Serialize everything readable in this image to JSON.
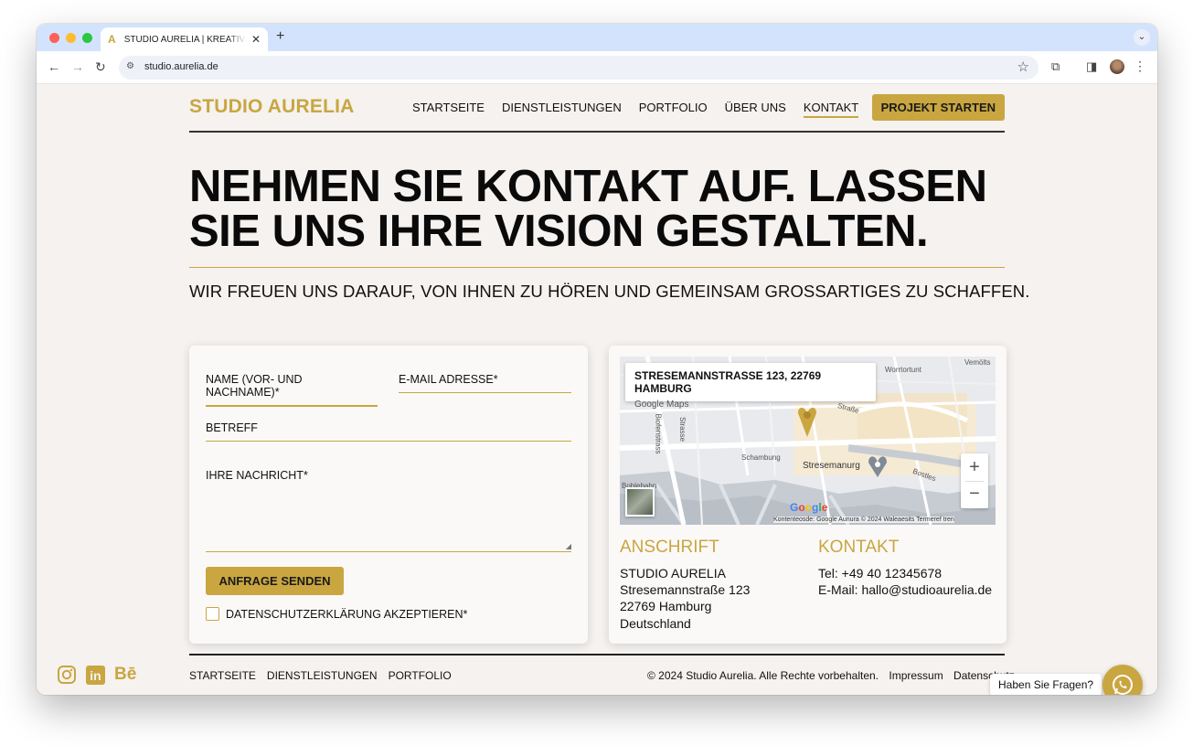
{
  "browser": {
    "tab_title": "STUDIO AURELIA | KREATIVAGENTUR",
    "tab_favicon": "A",
    "new_tab": "+",
    "close_tab": "✕",
    "url": "studio.aurelia.de"
  },
  "header": {
    "logo": "STUDIO AURELIA",
    "nav": [
      "STARTSEITE",
      "DIENSTLEISTUNGEN",
      "PORTFOLIO",
      "ÜBER UNS",
      "KONTAKT"
    ],
    "active_nav": "KONTAKT",
    "cta": "PROJEKT STARTEN"
  },
  "hero": {
    "line1": "NEHMEN SIE KONTAKT AUF. LASSEN",
    "line2": "SIE UNS IHRE VISION GESTALTEN.",
    "subtitle": "WIR FREUEN UNS DARAUF, VON IHNEN ZU HÖREN UND GEMEINSAM GROSSARTIGES ZU SCHAFFEN."
  },
  "form": {
    "name_label": "NAME (VOR- UND NACHNAME)*",
    "email_label": "E-MAIL ADRESSE*",
    "subject_label": "BETREFF",
    "message_label": "IHRE NACHRICHT*",
    "submit": "ANFRAGE SENDEN",
    "privacy": "DATENSCHUTZERKLÄRUNG AKZEPTIEREN*"
  },
  "map": {
    "info_title": "STRESEMANNSTRASSE 123, 22769 HAMBURG",
    "info_link": "Google Maps",
    "labels": {
      "top_right": "Vemölts",
      "top_mid": "Worrtortunt",
      "schambung": "Schambung",
      "stresemanurg": "Stresemanurg",
      "bostles": "Bostles",
      "boblebahn": "Boblebahn",
      "biofenstrass": "Biofenstrass",
      "strasse": "Strasse",
      "strabe": "Straße"
    },
    "zoom_in": "+",
    "zoom_out": "−",
    "google": "Google",
    "footer": "Kontenteosde: Google Aunura     © 2024 Waleaesits     Termeref tren",
    "pin_color": "#c9a640"
  },
  "address": {
    "heading": "ANSCHRIFT",
    "lines": [
      "STUDIO AURELIA",
      "Stresemannstraße 123",
      "22769 Hamburg",
      "Deutschland"
    ]
  },
  "contact": {
    "heading": "KONTAKT",
    "phone": "Tel: +49 40 12345678",
    "email": "E-Mail: hallo@studioaurelia.de"
  },
  "footer": {
    "nav": [
      "STARTSEITE",
      "DIENSTLEISTUNGEN",
      "PORTFOLIO"
    ],
    "copyright": "© 2024 Studio Aurelia. Alle Rechte vorbehalten.",
    "impressum": "Impressum",
    "datenschutz": "Datenschutz",
    "social": [
      "instagram-icon",
      "linkedin-icon",
      "behance-icon"
    ],
    "behance_text": "Bē",
    "linkedin_text": "in"
  },
  "chat": {
    "prompt": "Haben Sie Fragen?"
  },
  "colors": {
    "accent": "#c9a640",
    "background": "#f5f2f0",
    "tab_strip": "#d3e3fd"
  }
}
